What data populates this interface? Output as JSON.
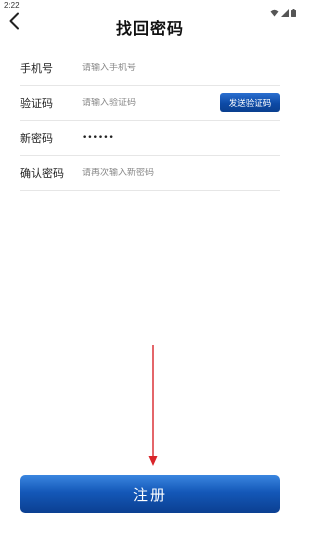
{
  "status_bar": {
    "time": "2:22",
    "icons": [
      "wifi-icon",
      "signal-icon",
      "battery-icon"
    ]
  },
  "header": {
    "back_icon": "chevron-left-icon",
    "title": "找回密码"
  },
  "form": {
    "phone": {
      "label": "手机号",
      "placeholder": "请输入手机号",
      "value": ""
    },
    "code": {
      "label": "验证码",
      "placeholder": "请输入验证码",
      "value": "",
      "send_button": "发送验证码"
    },
    "new_password": {
      "label": "新密码",
      "value": "••••••"
    },
    "confirm_password": {
      "label": "确认密码",
      "placeholder": "请再次输入新密码",
      "value": ""
    }
  },
  "register_button": "注册",
  "colors": {
    "accent": "#0d4aa6",
    "annotation_arrow": "#d9252a"
  }
}
